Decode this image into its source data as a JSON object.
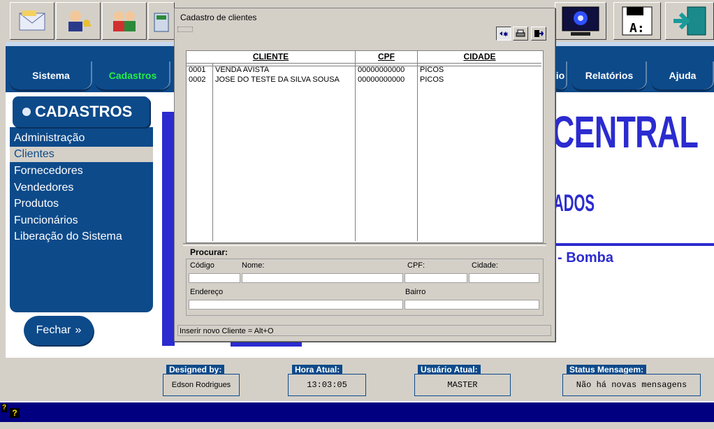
{
  "toolbar": {
    "icons": [
      "mail-icon",
      "user-key-icon",
      "users-icon",
      "calculator-icon",
      "monitor-icon",
      "disk-a-icon",
      "exit-door-icon"
    ]
  },
  "nav": {
    "tabs": [
      {
        "label": "Sistema"
      },
      {
        "label": "Cadastros"
      },
      {
        "label": "io"
      },
      {
        "label": "Relatórios"
      },
      {
        "label": "Ajuda"
      }
    ]
  },
  "sidebar": {
    "title": "CADASTROS",
    "items": [
      {
        "label": "Administração"
      },
      {
        "label": "Clientes"
      },
      {
        "label": "Fornecedores"
      },
      {
        "label": "Vendedores"
      },
      {
        "label": "Produtos"
      },
      {
        "label": "Funcionários"
      },
      {
        "label": "Liberação do Sistema"
      }
    ],
    "selected": "Clientes",
    "close_label": "Fechar"
  },
  "background": {
    "title": "CENTRAL",
    "subtitle": "ADOS",
    "tagline": "- Bomba"
  },
  "dialog": {
    "title": "Cadastro de clientes",
    "columns": [
      "CLIENTE",
      "CPF",
      "CIDADE"
    ],
    "rows": [
      {
        "code": "0001",
        "name": "VENDA AVISTA",
        "cpf": "00000000000",
        "city": "PICOS"
      },
      {
        "code": "0002",
        "name": "JOSE DO TESTE DA SILVA SOUSA",
        "cpf": "00000000000",
        "city": "PICOS"
      }
    ],
    "search_label": "Procurar:",
    "fields": {
      "codigo": "Código",
      "nome": "Nome:",
      "cpf": "CPF:",
      "cidade": "Cidade:",
      "endereco": "Endereço",
      "bairro": "Bairro"
    },
    "status": "Inserir novo Cliente = Alt+O"
  },
  "status": {
    "designed_label": "Designed by:",
    "designed_value": "Edson Rodrigues",
    "time_label": "Hora Atual:",
    "time_value": "13:03:05",
    "user_label": "Usuário Atual:",
    "user_value": "MASTER",
    "msg_label": "Status Mensagem:",
    "msg_value": "Não há novas mensagens"
  },
  "colors": {
    "nav_blue": "#0d4a8a",
    "accent_green": "#22ee44",
    "title_blue": "#2b2bd0"
  }
}
